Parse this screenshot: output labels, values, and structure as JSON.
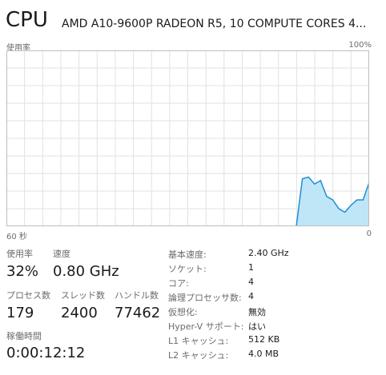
{
  "header": {
    "title": "CPU",
    "processor_name": "AMD A10-9600P RADEON R5, 10 COMPUTE CORES 4..."
  },
  "graph": {
    "label_top_left": "使用率",
    "label_top_right": "100%",
    "label_bottom_left": "60 秒",
    "label_bottom_right": "0",
    "line_color": "#1e8fd6",
    "fill_color": "#bfe6f7",
    "grid_color": "#e2e2e2",
    "border_color": "#bdbdbd",
    "usage_history_percent": [
      0,
      27,
      28,
      24,
      26,
      17,
      15,
      10,
      8,
      12,
      15,
      15,
      25
    ]
  },
  "stats": {
    "utilization": {
      "label": "使用率",
      "value": "32%"
    },
    "speed": {
      "label": "速度",
      "value": "0.80 GHz"
    },
    "processes": {
      "label": "プロセス数",
      "value": "179"
    },
    "threads": {
      "label": "スレッド数",
      "value": "2400"
    },
    "handles": {
      "label": "ハンドル数",
      "value": "77462"
    },
    "uptime": {
      "label": "稼働時間",
      "value": "0:00:12:12"
    }
  },
  "specs": [
    {
      "key": "基本速度:",
      "value": "2.40 GHz"
    },
    {
      "key": "ソケット:",
      "value": "1"
    },
    {
      "key": "コア:",
      "value": "4"
    },
    {
      "key": "論理プロセッサ数:",
      "value": "4"
    },
    {
      "key": "仮想化:",
      "value": "無効"
    },
    {
      "key": "Hyper-V サポート:",
      "value": "はい"
    },
    {
      "key": "L1 キャッシュ:",
      "value": "512 KB"
    },
    {
      "key": "L2 キャッシュ:",
      "value": "4.0 MB"
    }
  ]
}
